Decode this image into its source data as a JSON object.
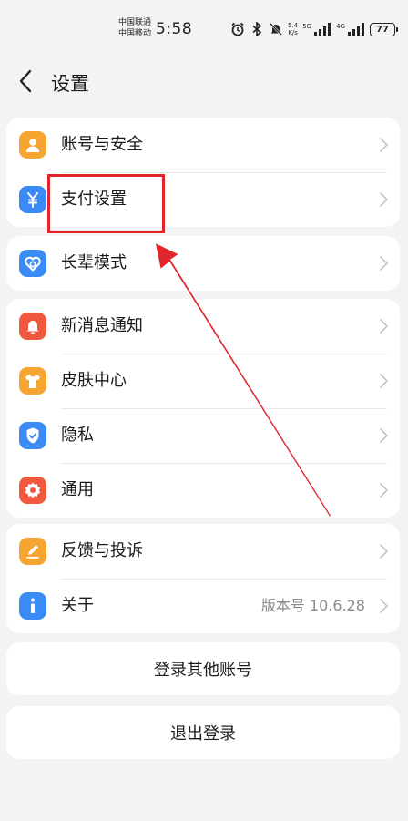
{
  "status_bar": {
    "carrier_1": "中国联通",
    "carrier_2": "中国移动",
    "time": "5:58",
    "net_speed_value": "5.4",
    "net_speed_unit": "K/s",
    "sim1_tag": "5G",
    "sim2_tag": "4G",
    "battery": "77",
    "icons": [
      "alarm-icon",
      "bluetooth-icon",
      "mute-icon",
      "signal-icon",
      "battery-icon"
    ]
  },
  "header": {
    "title": "设置"
  },
  "groups": [
    {
      "rows": [
        {
          "label": "账号与安全",
          "icon": "account-icon",
          "color": "#f6a531"
        },
        {
          "label": "支付设置",
          "icon": "payment-yuan-icon",
          "color": "#3a8bf5"
        }
      ]
    },
    {
      "rows": [
        {
          "label": "长辈模式",
          "icon": "elder-mode-icon",
          "color": "#3a8bf5"
        }
      ]
    },
    {
      "rows": [
        {
          "label": "新消息通知",
          "icon": "bell-icon",
          "color": "#f2573f"
        },
        {
          "label": "皮肤中心",
          "icon": "tshirt-icon",
          "color": "#f6a531"
        },
        {
          "label": "隐私",
          "icon": "shield-icon",
          "color": "#3a8bf5"
        },
        {
          "label": "通用",
          "icon": "gear-icon",
          "color": "#f2573f"
        }
      ]
    },
    {
      "rows": [
        {
          "label": "反馈与投诉",
          "icon": "feedback-pen-icon",
          "color": "#f6a531"
        },
        {
          "label": "关于",
          "icon": "info-icon",
          "color": "#3a8bf5",
          "value": "版本号 10.6.28"
        }
      ]
    }
  ],
  "buttons": {
    "login_other": "登录其他账号",
    "logout": "退出登录"
  },
  "annotation": {
    "highlight_color": "#e0262a"
  }
}
